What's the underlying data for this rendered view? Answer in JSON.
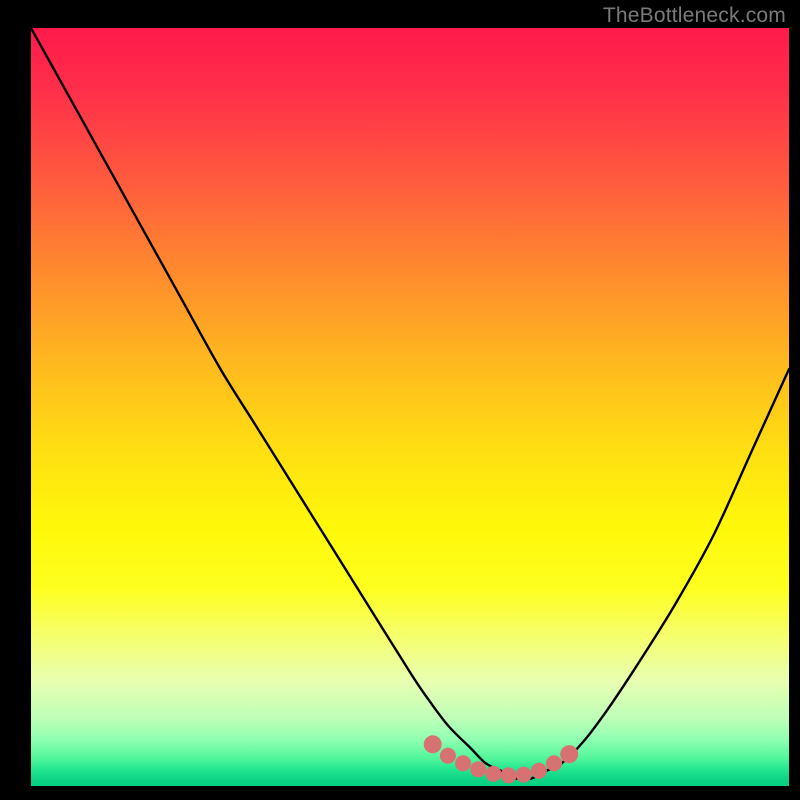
{
  "watermark": "TheBottleneck.com",
  "colors": {
    "frame": "#000000",
    "curve": "#000000",
    "markers": "#d87272",
    "gradient_top": "#ff1a4b",
    "gradient_mid": "#ffe012",
    "gradient_bottom": "#06cf80"
  },
  "chart_data": {
    "type": "line",
    "title": "",
    "xlabel": "",
    "ylabel": "",
    "xlim": [
      0,
      100
    ],
    "ylim": [
      0,
      100
    ],
    "grid": false,
    "legend": false,
    "annotations": [
      "TheBottleneck.com"
    ],
    "series": [
      {
        "name": "bottleneck-curve",
        "x": [
          0,
          5,
          10,
          15,
          20,
          25,
          30,
          35,
          40,
          45,
          50,
          52,
          55,
          58,
          60,
          62,
          64,
          66,
          68,
          70,
          73,
          76,
          80,
          85,
          90,
          95,
          100
        ],
        "values": [
          100,
          91,
          82,
          73,
          64,
          55,
          47,
          39,
          31,
          23,
          15,
          12,
          8,
          5,
          3,
          2,
          1,
          1,
          2,
          3,
          6,
          10,
          16,
          24,
          33,
          44,
          55
        ]
      }
    ],
    "markers": {
      "name": "highlight-points",
      "x": [
        53,
        55,
        57,
        59,
        61,
        63,
        65,
        67,
        69,
        71
      ],
      "values": [
        5.5,
        4.0,
        3.0,
        2.2,
        1.6,
        1.4,
        1.5,
        2.0,
        3.0,
        4.2
      ]
    }
  }
}
